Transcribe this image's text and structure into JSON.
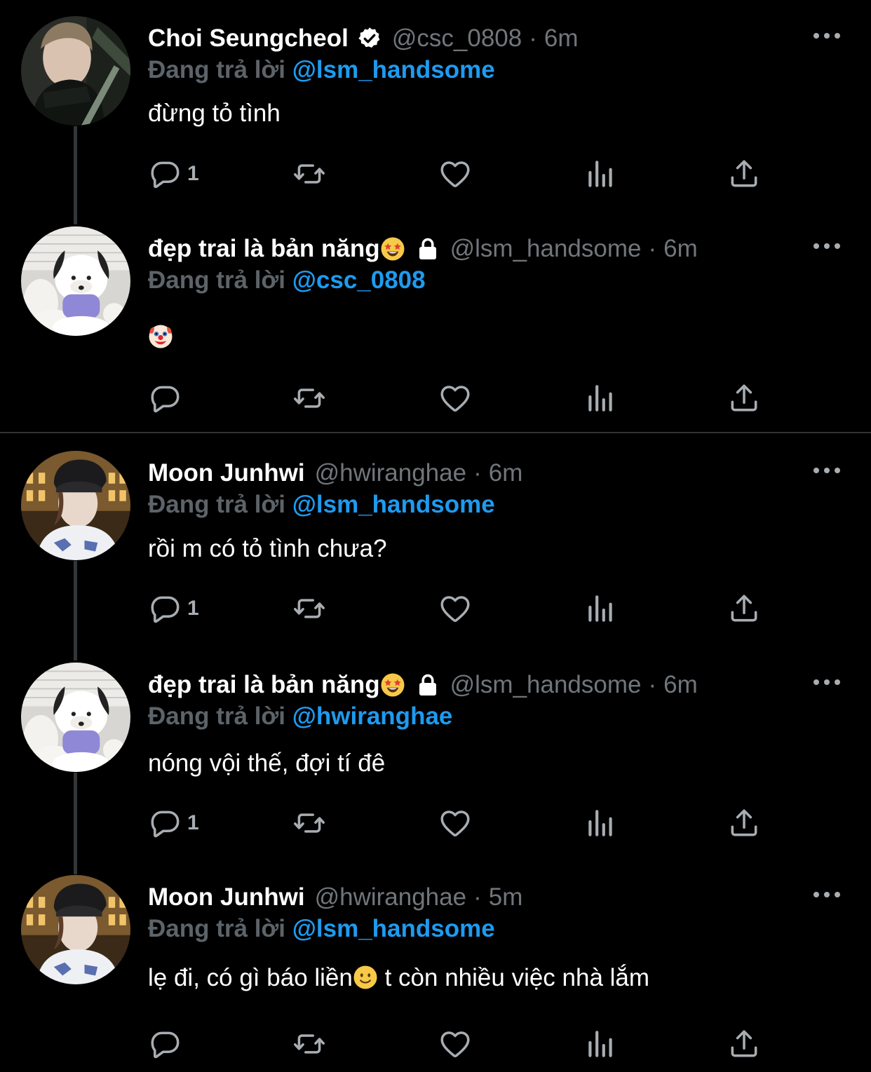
{
  "reply_prefix": "Đang trả lời",
  "tweets": [
    {
      "name": "Choi Seungcheol",
      "verified": true,
      "handle": "@csc_0808",
      "separator": "·",
      "time": "6m",
      "replying_to": "@lsm_handsome",
      "text": "đừng tỏ tình",
      "reply_count": "1"
    },
    {
      "name": "đẹp trai là bản năng",
      "name_emoji": "star-struck-emoji",
      "locked": true,
      "handle": "@lsm_handsome",
      "separator": "·",
      "time": "6m",
      "replying_to": "@csc_0808",
      "text": "",
      "text_emoji": "clown-face-emoji",
      "reply_count": ""
    },
    {
      "name": "Moon Junhwi",
      "handle": "@hwiranghae",
      "separator": "·",
      "time": "6m",
      "replying_to": "@lsm_handsome",
      "text": "rồi m có tỏ tình chưa?",
      "reply_count": "1"
    },
    {
      "name": "đẹp trai là bản năng",
      "name_emoji": "star-struck-emoji",
      "locked": true,
      "handle": "@lsm_handsome",
      "separator": "·",
      "time": "6m",
      "replying_to": "@hwiranghae",
      "text": "nóng vội thế, đợi tí đê",
      "reply_count": "1"
    },
    {
      "name": "Moon Junhwi",
      "handle": "@hwiranghae",
      "separator": "·",
      "time": "5m",
      "replying_to": "@lsm_handsome",
      "text_part1": "lẹ đi, có gì báo liền",
      "text_emoji": "slightly-smiling-emoji",
      "text_part2": " t còn nhiều việc nhà lắm",
      "reply_count": ""
    }
  ],
  "colors": {
    "background": "#000000",
    "text_primary": "#ffffff",
    "text_secondary": "#71767b",
    "link": "#1d9bf0",
    "icon": "#a8adb2",
    "thread_line": "#333639"
  }
}
